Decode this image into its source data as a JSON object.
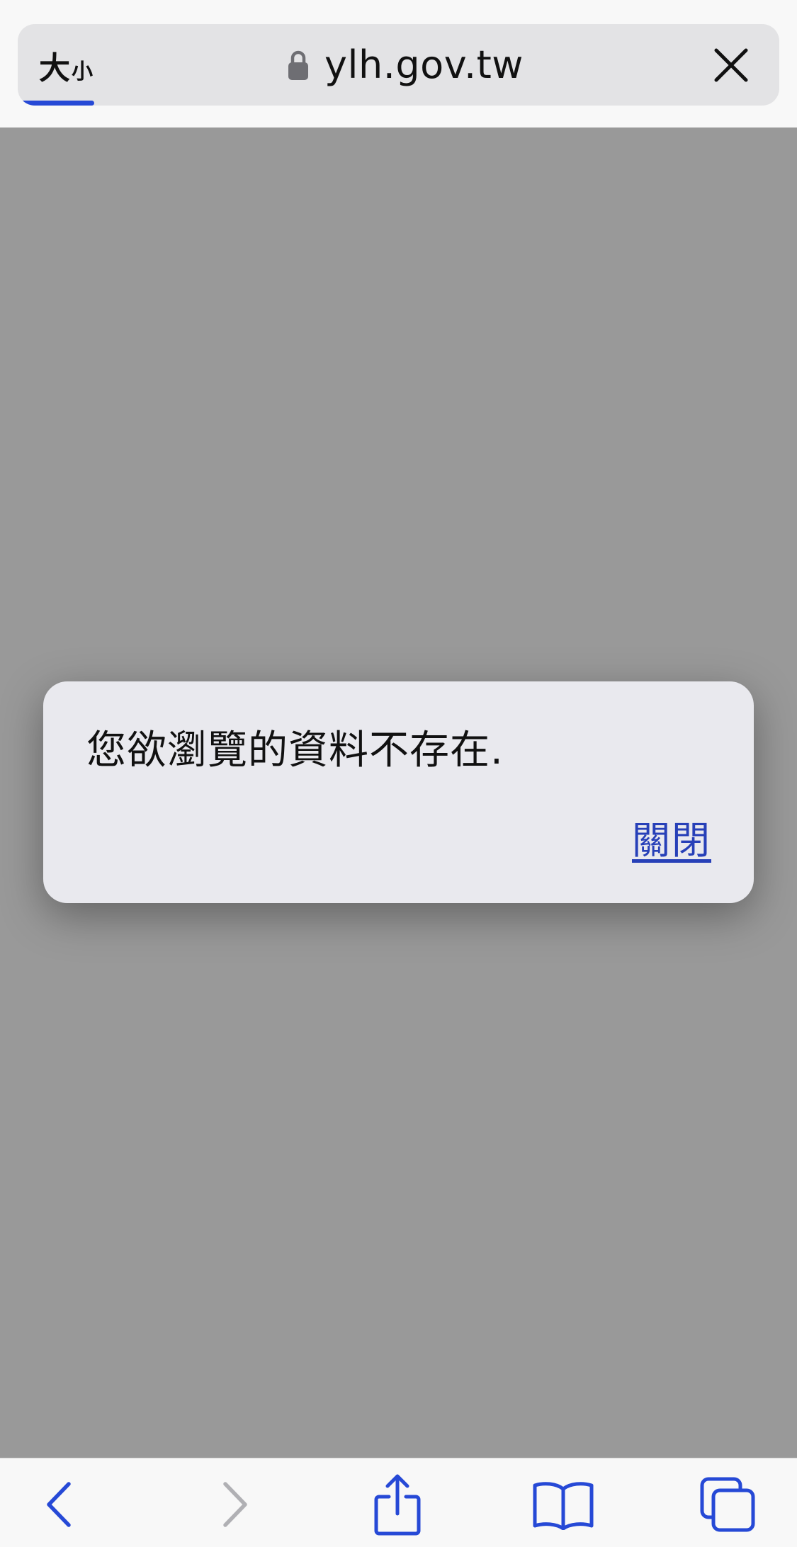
{
  "browser": {
    "text_size_big": "大",
    "text_size_small": "小",
    "url": "ylh.gov.tw",
    "load_progress": 0.1
  },
  "alert": {
    "message": "您欲瀏覽的資料不存在.",
    "close_label": "關閉"
  },
  "toolbar": {
    "items": [
      "back-icon",
      "forward-icon",
      "share-icon",
      "bookmarks-icon",
      "tabs-icon"
    ]
  },
  "colors": {
    "accent": "#2649d6",
    "link": "#2740b8",
    "page_overlay": "#999999",
    "dialog_bg": "#e9e9ee"
  }
}
